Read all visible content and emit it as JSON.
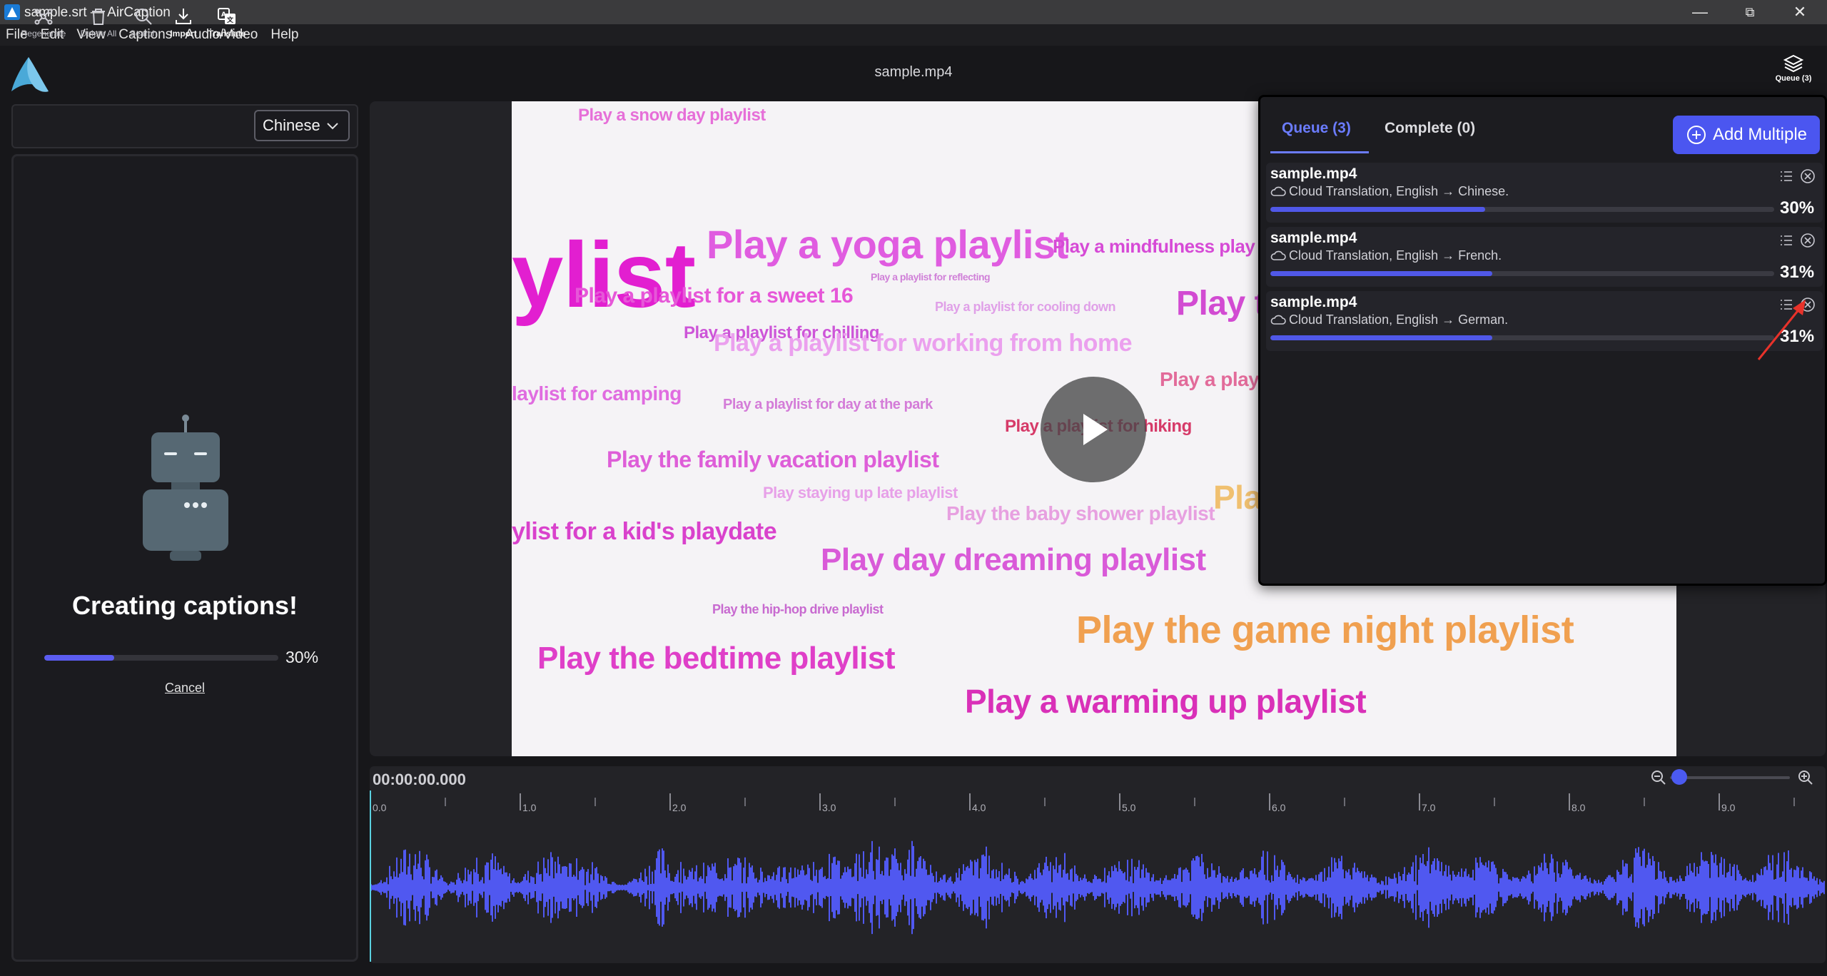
{
  "window": {
    "title": "sample.srt — AirCaption",
    "controls": {
      "minimize": "—",
      "maximize": "⧉",
      "close": "✕"
    }
  },
  "menu": [
    "File",
    "Edit",
    "View",
    "Captions",
    "Audio/Video",
    "Help"
  ],
  "header": {
    "filename": "sample.mp4",
    "queue_button_label": "Queue (3)"
  },
  "toolbar": {
    "regenerate": "Regenerate",
    "delete_all": "Delete All",
    "search": "Search",
    "import": "Import",
    "translate": "Translate",
    "language": "Chinese"
  },
  "left_panel": {
    "status": "Creating captions!",
    "progress_text": "30%",
    "progress_value": 0.3,
    "cancel": "Cancel"
  },
  "video_text": [
    {
      "t": "Play a snow day playlist"
    },
    {
      "t": "ylist"
    },
    {
      "t": "Play a yoga playlist"
    },
    {
      "t": "Play a mindfulness play"
    },
    {
      "t": "Play a playlist for a sweet 16"
    },
    {
      "t": "Play a playlist for chilling"
    },
    {
      "t": "Play a playlist for working from home"
    },
    {
      "t": "Play t"
    },
    {
      "t": "laylist for camping"
    },
    {
      "t": "Play a playlist for day at the park"
    },
    {
      "t": "Play a play"
    },
    {
      "t": "Play a playlist for hiking"
    },
    {
      "t": "Play the family vacation playlist"
    },
    {
      "t": "Play staying up late playlist"
    },
    {
      "t": "Play the baby shower playlist"
    },
    {
      "t": "ylist for a kid's playdate"
    },
    {
      "t": "Play day dreaming playlist"
    },
    {
      "t": "Play the hip-hop drive playlist"
    },
    {
      "t": "Play the bedtime playlist"
    },
    {
      "t": "Play the game night playlist"
    },
    {
      "t": "Play a warming up playlist"
    },
    {
      "t": "Pla"
    },
    {
      "t": "Play a playlist for reflecting"
    },
    {
      "t": "Play a playlist for cooling down"
    }
  ],
  "queue": {
    "tab_queue": "Queue (3)",
    "tab_complete": "Complete (0)",
    "add_multiple": "Add Multiple",
    "items": [
      {
        "name": "sample.mp4",
        "desc": "Cloud Translation, English → Chinese.",
        "pct": "30%",
        "progress": 0.3
      },
      {
        "name": "sample.mp4",
        "desc": "Cloud Translation, English → French.",
        "pct": "31%",
        "progress": 0.31
      },
      {
        "name": "sample.mp4",
        "desc": "Cloud Translation, English → German.",
        "pct": "31%",
        "progress": 0.31
      }
    ]
  },
  "timeline": {
    "timecode": "00:00:00.000",
    "ticks": [
      "0.0",
      "1.0",
      "2.0",
      "3.0",
      "4.0",
      "5.0",
      "6.0",
      "7.0",
      "8.0",
      "9.0"
    ],
    "zoom_level": 0.05,
    "colors": {
      "wave": "#5058f0",
      "accent": "#4b56f0"
    }
  }
}
